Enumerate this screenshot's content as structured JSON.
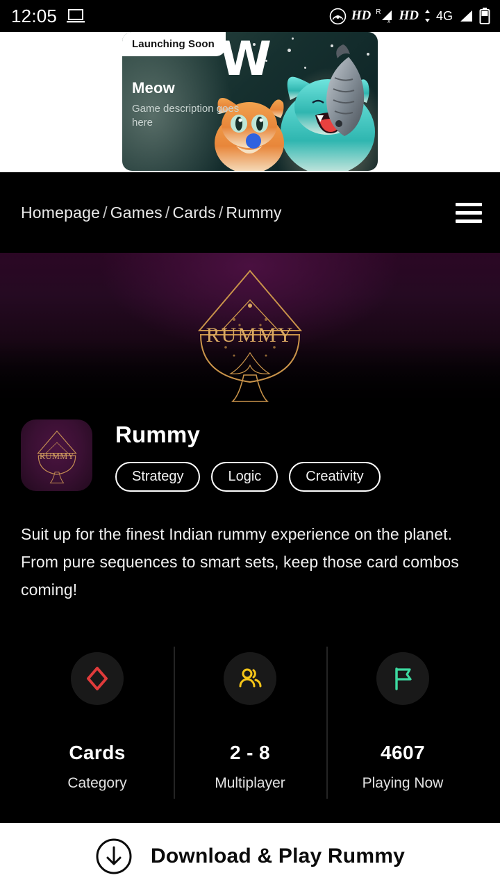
{
  "status_bar": {
    "time": "12:05",
    "left_icon": "laptop-icon",
    "right_icons": [
      "hotspot-icon",
      "hd-label-1",
      "roaming-signal-icon",
      "hd-label-2",
      "data-arrows-icon",
      "network-4g",
      "signal-bars-icon",
      "battery-icon"
    ],
    "hd_label_1": "HD",
    "roaming_label": "R",
    "hd_label_2": "HD",
    "network_label": "4G"
  },
  "promo_banner": {
    "badge": "Launching Soon",
    "title": "Meow",
    "description": "Game description goes here",
    "watermark_letter": "W"
  },
  "breadcrumb": {
    "items": [
      "Homepage",
      "Games",
      "Cards",
      "Rummy"
    ],
    "separator": "/",
    "menu_icon": "hamburger-menu-icon"
  },
  "hero": {
    "logo_text": "RUMMY",
    "logo_alt": "rummy-spade-logo"
  },
  "game": {
    "icon_alt": "rummy-app-icon",
    "title": "Rummy",
    "tags": [
      "Strategy",
      "Logic",
      "Creativity"
    ],
    "description": "Suit up for the finest Indian rummy experience on the planet. From pure sequences to smart sets, keep those card combos coming!"
  },
  "stats": [
    {
      "icon": "diamond-suit-icon",
      "value": "Cards",
      "label": "Category",
      "color": "#e03b3b"
    },
    {
      "icon": "people-icon",
      "value": "2 - 8",
      "label": "Multiplayer",
      "color": "#f5c518"
    },
    {
      "icon": "flag-icon",
      "value": "4607",
      "label": "Playing Now",
      "color": "#3dd9a0"
    }
  ],
  "cta": {
    "icon": "download-circle-icon",
    "label": "Download & Play Rummy"
  },
  "colors": {
    "background": "#000000",
    "cta_background": "#ffffff",
    "hero_purple": "#2b0724",
    "accent_gold": "#c9934a"
  }
}
